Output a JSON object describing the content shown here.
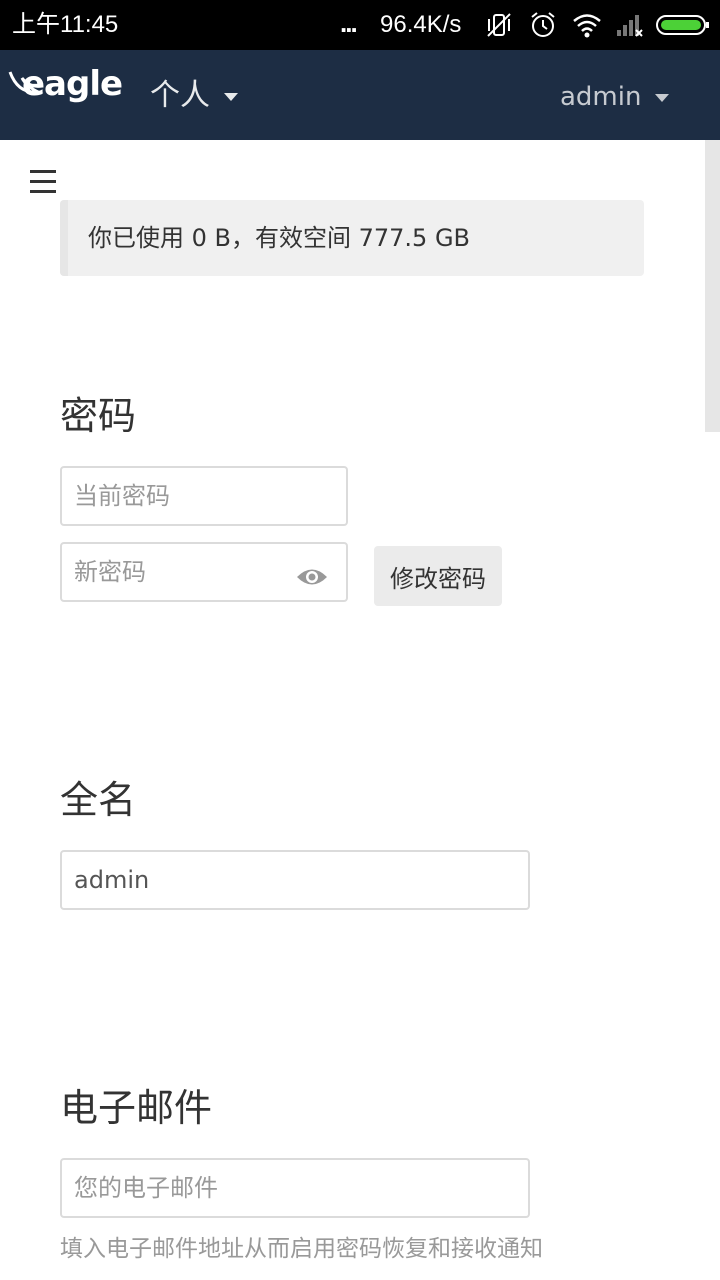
{
  "statusbar": {
    "time": "上午11:45",
    "dots": "...",
    "speed": "96.4K/s",
    "icons": [
      "vibrate-off-icon",
      "alarm-icon",
      "wifi-icon",
      "signal-icon",
      "battery-icon"
    ]
  },
  "navbar": {
    "logo_text": "eagle",
    "app_label": "个人",
    "user_label": "admin",
    "background": "#1d2d44"
  },
  "quota": {
    "text": "你已使用 0 B，有效空间 777.5 GB"
  },
  "password": {
    "title": "密码",
    "current_placeholder": "当前密码",
    "new_placeholder": "新密码",
    "change_button": "修改密码"
  },
  "fullname": {
    "title": "全名",
    "value": "admin"
  },
  "email": {
    "title": "电子邮件",
    "placeholder": "您的电子邮件",
    "hint": "填入电子邮件地址从而启用密码恢复和接收通知"
  }
}
